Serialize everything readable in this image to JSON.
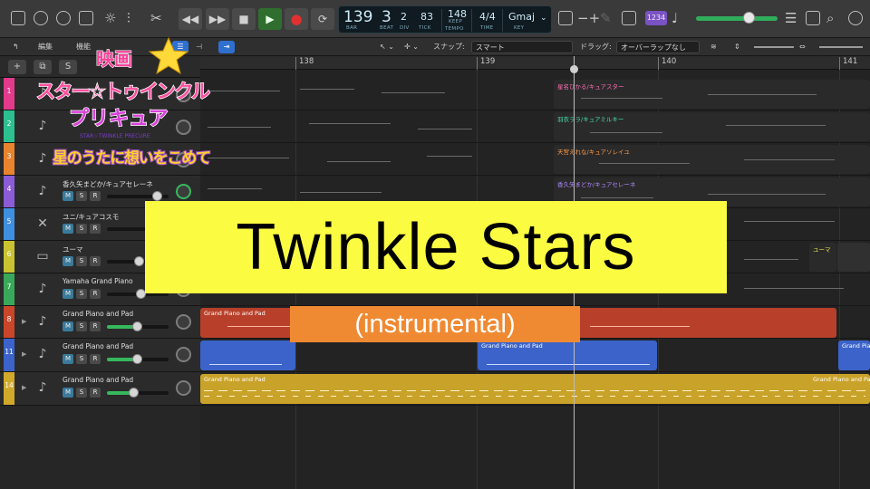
{
  "transport": {
    "lcd": {
      "bar": "139",
      "beat": "3",
      "div": "2",
      "tick": "83",
      "bar_cap": "BAR",
      "beat_cap": "BEAT",
      "div_cap": "DIV",
      "tick_cap": "TICK",
      "tempo": "148",
      "tempo_mode": "KEEP",
      "tempo_cap": "TEMPO",
      "time_sig": "4/4",
      "time_cap": "TIME",
      "key": "Gmaj",
      "key_cap": "KEY"
    },
    "count_in": "1234"
  },
  "toolbar2": {
    "edit_menu": "編集",
    "function_menu": "機能",
    "snap_label": "スナップ:",
    "snap_value": "スマート",
    "drag_label": "ドラッグ:",
    "drag_value": "オーバーラップなし"
  },
  "ruler": {
    "bars": [
      "138",
      "139",
      "140",
      "141"
    ]
  },
  "tracks": [
    {
      "number": "1",
      "name": "星名ひかる/キュアスター",
      "color": "#e33a8b",
      "region_label": "星名ひかる/キュアスター",
      "label_color": "#ff6fb5"
    },
    {
      "number": "2",
      "name": "羽衣ララ/キュアミルキー",
      "color": "#2dbf8f",
      "region_label": "羽衣ララ/キュアミルキー",
      "label_color": "#45e0ac"
    },
    {
      "number": "3",
      "name": "天宮えれな/キュアソレイユ",
      "color": "#e8832e",
      "region_label": "天宮えれな/キュアソレイユ",
      "label_color": "#ff9a47"
    },
    {
      "number": "4",
      "name": "香久矢まどか/キュアセレーネ",
      "color": "#8b5cd6",
      "region_label": "香久矢まどか/キュアセレーネ",
      "label_color": "#b08aff"
    },
    {
      "number": "5",
      "name": "ユニ/キュアコスモ",
      "color": "#3f8fe0",
      "region_label": "",
      "label_color": "#7fb7ff"
    },
    {
      "number": "6",
      "name": "ユーマ",
      "color": "#c9c331",
      "region_label": "ユーマ",
      "label_color": "#e6df45"
    },
    {
      "number": "7",
      "name": "Yamaha Grand Piano",
      "color": "#3aa85a",
      "region_label": "",
      "label_color": "#66d88a"
    },
    {
      "number": "8",
      "name": "Grand Piano and Pad",
      "color": "#c9462b",
      "region_label": "Grand Piano and Pad",
      "label_color": "#ffffff"
    },
    {
      "number": "11",
      "name": "Grand Piano and Pad",
      "color": "#3b63c9",
      "region_label": "Grand Piano and Pad",
      "label_color": "#ffffff"
    },
    {
      "number": "14",
      "name": "Grand Piano and Pad",
      "color": "#d1a92a",
      "region_label": "Grand Piano and Pad",
      "label_color": "#ffffff"
    }
  ],
  "mute_label": "M",
  "solo_label": "S",
  "rec_label": "R",
  "overlay": {
    "logo": {
      "line1": "映画",
      "line2": "スター☆トゥインクル",
      "line3": "プリキュア",
      "line4": "STAR☆TWINKLE PRECURE",
      "line5": "星のうたに想いをこめて"
    },
    "title": "Twinkle Stars",
    "subtitle": "(instrumental)"
  },
  "icons": {
    "top_left": [
      "inbox-icon",
      "info-icon",
      "help-icon",
      "download-icon"
    ],
    "top_mid": [
      "brightness-icon",
      "mixer-icon",
      "scissors-icon"
    ],
    "top_right": [
      "list-icon",
      "note-icon",
      "browser-icon",
      "smiley-icon"
    ]
  }
}
